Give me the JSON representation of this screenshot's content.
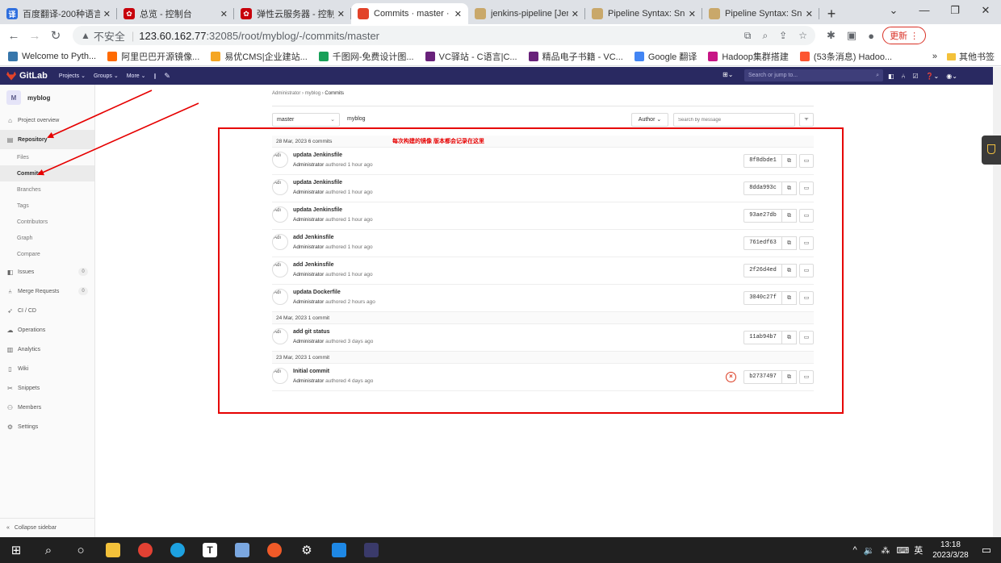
{
  "browser": {
    "tabs": [
      {
        "label": "百度翻译-200种语言",
        "color": "#2f6fde",
        "glyph": "译",
        "active": false
      },
      {
        "label": "总览 - 控制台",
        "color": "#c7000b",
        "glyph": "✿",
        "active": false
      },
      {
        "label": "弹性云服务器 - 控制台",
        "color": "#c7000b",
        "glyph": "✿",
        "active": false
      },
      {
        "label": "Commits · master · /",
        "color": "#e24329",
        "glyph": "",
        "active": true
      },
      {
        "label": "jenkins-pipeline [Jen",
        "color": "#c9a86a",
        "glyph": "",
        "active": false
      },
      {
        "label": "Pipeline Syntax: Snip",
        "color": "#c9a86a",
        "glyph": "",
        "active": false
      },
      {
        "label": "Pipeline Syntax: Snip",
        "color": "#c9a86a",
        "glyph": "",
        "active": false
      }
    ],
    "insecure_label": "不安全",
    "url_host": "123.60.162.77",
    "url_rest": ":32085/root/myblog/-/commits/master",
    "update_label": "更新",
    "bookmarks": [
      {
        "label": "Welcome to Pyth...",
        "color": "#3776ab"
      },
      {
        "label": "阿里巴巴开源镜像...",
        "color": "#ff6a00"
      },
      {
        "label": "易优CMS|企业建站...",
        "color": "#f5a623"
      },
      {
        "label": "千图网-免费设计图...",
        "color": "#18a058"
      },
      {
        "label": "VC驿站 - C语言|C...",
        "color": "#68217a"
      },
      {
        "label": "精品电子书籍 - VC...",
        "color": "#68217a"
      },
      {
        "label": "Google 翻译",
        "color": "#4285f4"
      },
      {
        "label": "Hadoop集群搭建",
        "color": "#c71585"
      },
      {
        "label": "(53条消息) Hadoo...",
        "color": "#fc5531"
      }
    ],
    "bookmarks_more": "»",
    "other_bookmarks": "其他书签"
  },
  "gitlab": {
    "logo": "GitLab",
    "nav": [
      "Projects ⌄",
      "Groups ⌄",
      "More ⌄"
    ],
    "search_placeholder": "Search or jump to..."
  },
  "sidebar": {
    "project_initial": "M",
    "project_name": "myblog",
    "project_overview": "Project overview",
    "repository": "Repository",
    "repo_items": [
      "Files",
      "Commits",
      "Branches",
      "Tags",
      "Contributors",
      "Graph",
      "Compare"
    ],
    "issues": "Issues",
    "issues_count": "0",
    "merge_requests": "Merge Requests",
    "mr_count": "0",
    "cicd": "CI / CD",
    "operations": "Operations",
    "analytics": "Analytics",
    "wiki": "Wiki",
    "snippets": "Snippets",
    "members": "Members",
    "settings": "Settings",
    "collapse": "Collapse sidebar"
  },
  "main": {
    "breadcrumb": [
      "Administrator",
      "myblog",
      "Commits"
    ],
    "branch": "master",
    "path": "myblog",
    "author_label": "Author ⌄",
    "search_placeholder": "Search by message",
    "annotation": "每次构建的镜像 版本都会记录在这里",
    "groups": [
      {
        "date": "28 Mar, 2023 6 commits",
        "commits": [
          {
            "title": "updata Jenkinsfile",
            "author": "Administrator",
            "time": "authored 1 hour ago",
            "sha": "8f8dbde1",
            "failed": false
          },
          {
            "title": "updata Jenkinsfile",
            "author": "Administrator",
            "time": "authored 1 hour ago",
            "sha": "8dda993c",
            "failed": false
          },
          {
            "title": "updata Jenkinsfile",
            "author": "Administrator",
            "time": "authored 1 hour ago",
            "sha": "93ae27db",
            "failed": false
          },
          {
            "title": "add Jenkinsfile",
            "author": "Administrator",
            "time": "authored 1 hour ago",
            "sha": "761edf63",
            "failed": false
          },
          {
            "title": "add Jenkinsfile",
            "author": "Administrator",
            "time": "authored 1 hour ago",
            "sha": "2f26d4ed",
            "failed": false
          },
          {
            "title": "updata Dockerfile",
            "author": "Administrator",
            "time": "authored 2 hours ago",
            "sha": "3040c27f",
            "failed": false
          }
        ]
      },
      {
        "date": "24 Mar, 2023 1 commit",
        "commits": [
          {
            "title": "add git status",
            "author": "Administrator",
            "time": "authored 3 days ago",
            "sha": "11ab94b7",
            "failed": false
          }
        ]
      },
      {
        "date": "23 Mar, 2023 1 commit",
        "commits": [
          {
            "title": "Initial commit",
            "author": "Administrator",
            "time": "authored 4 days ago",
            "sha": "b2737497",
            "failed": true
          }
        ]
      }
    ],
    "avatar_alt": "Adı"
  },
  "taskbar": {
    "time": "13:18",
    "date": "2023/3/28",
    "ime": "英"
  }
}
